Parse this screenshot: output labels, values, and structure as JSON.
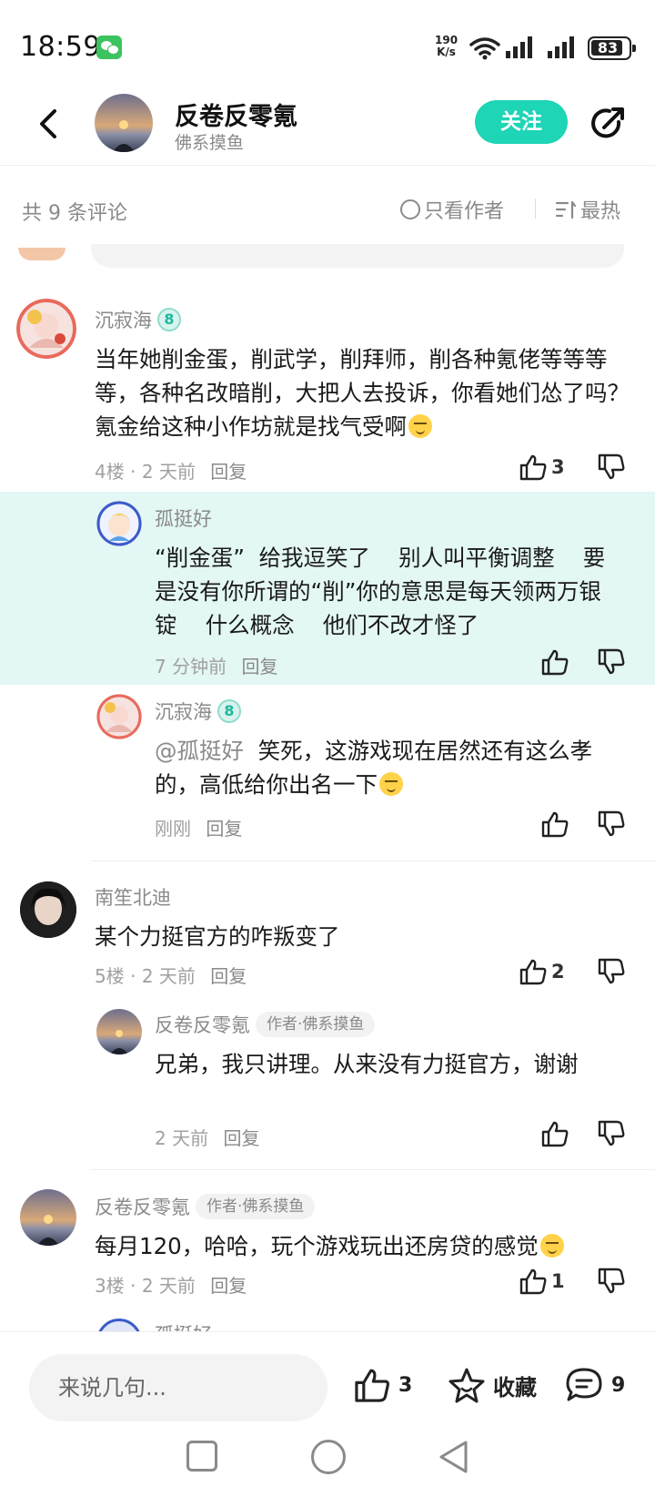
{
  "status_bar": {
    "time": "18:59",
    "net_speed_value": "190",
    "net_speed_unit": "K/s",
    "battery": "83"
  },
  "header": {
    "title": "反卷反零氪",
    "subtitle": "佛系摸鱼",
    "follow_label": "关注"
  },
  "filter": {
    "count_label": "共 9 条评论",
    "author_only_label": "只看作者",
    "sort_label": "最热"
  },
  "comments": [
    {
      "user": "沉寂海",
      "level": "8",
      "text": "当年她削金蛋，削武学，削拜师，削各种氪佬等等等等，各种名改暗削，大把人去投诉，你看她们怂了吗？氪金给这种小作坊就是找气受啊",
      "floor": "4楼",
      "time": "2 天前",
      "reply_label": "回复",
      "likes": "3",
      "replies": [
        {
          "user": "孤挺好",
          "text": "“削金蛋”  给我逗笑了    别人叫平衡调整    要是没有你所谓的“削”你的意思是每天领两万银锭    什么概念    他们不改才怪了",
          "time": "7 分钟前",
          "reply_label": "回复"
        },
        {
          "user": "沉寂海",
          "level": "8",
          "mention": "@孤挺好",
          "text": "笑死，这游戏现在居然还有这么孝的，高低给你出名一下",
          "time": "刚刚",
          "reply_label": "回复"
        }
      ]
    },
    {
      "user": "南笙北迪",
      "text": "某个力挺官方的咋叛变了",
      "floor": "5楼",
      "time": "2 天前",
      "reply_label": "回复",
      "likes": "2",
      "replies": [
        {
          "user": "反卷反零氪",
          "tag": "作者·佛系摸鱼",
          "text": "兄弟，我只讲理。从来没有力挺官方，谢谢",
          "time": "2 天前",
          "reply_label": "回复"
        }
      ]
    },
    {
      "user": "反卷反零氪",
      "tag": "作者·佛系摸鱼",
      "text": "每月120，哈哈，玩个游戏玩出还房贷的感觉",
      "floor": "3楼",
      "time": "2 天前",
      "reply_label": "回复",
      "likes": "1",
      "replies": [
        {
          "user": "孤挺好"
        }
      ]
    }
  ],
  "bottom_bar": {
    "input_placeholder": "来说几句...",
    "like_count": "3",
    "favorite_label": "收藏",
    "comment_count": "9"
  },
  "icons": {
    "back": "chevron-left-icon",
    "share": "share-icon",
    "thumb_up": "thumb-up-icon",
    "thumb_down": "thumb-down-icon",
    "star": "star-icon",
    "comment": "comment-bubble-icon",
    "sort": "sort-icon"
  },
  "colors": {
    "accent": "#1ed5b6",
    "highlight_bg": "#e3f7f4",
    "muted_text": "#8a8a8a"
  }
}
